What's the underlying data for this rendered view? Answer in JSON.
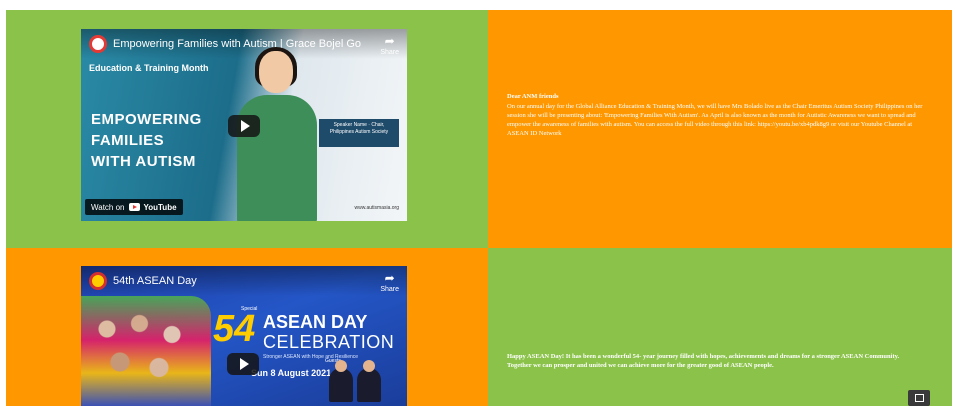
{
  "row1": {
    "video": {
      "title": "Empowering Families with Autism | Grace Bojel Go",
      "subtitle": "Education & Training Month",
      "headline_lines": [
        "EMPOWERING",
        "FAMILIES",
        "WITH AUTISM"
      ],
      "lower_third": "Speaker Name · Chair, Philippines Autism Society",
      "url": "www.autismasia.org",
      "watch_on": "Watch on",
      "youtube": "YouTube",
      "share": "Share"
    },
    "text": {
      "greeting": "Dear ANM friends",
      "body": "On our annual day for the Global Alliance Education & Training Month, we will have Mrs Bolado live as the Chair Emeritus Autism Society Philippines on her session she will be presenting about: 'Empowering Families With Autism'. As April is also known as the month for Autistic Awareness we want to spread and empower the awareness of families with autism. You can access the full video through this link: https://youtu.be/xb4pdk8g9 or visit our Youtube Channel at ASEAN ID Network"
    }
  },
  "row2": {
    "video": {
      "title": "54th ASEAN Day",
      "anniversary": "54",
      "pre_title": "Special",
      "title_line1": "ASEAN DAY",
      "title_line2": "CELEBRATION",
      "tagline": "Stronger ASEAN with Hope and Resilience",
      "date": "Sun 8 August 2021",
      "speakers": "Guests",
      "share": "Share"
    },
    "text": {
      "body": "Happy ASEAN Day! It has been a wonderful 54- year journey filled with hopes, achievements and dreams for a stronger ASEAN Community. Together we can prosper and united we can achieve more for the greater good of ASEAN people."
    }
  },
  "colors": {
    "green": "#8bc34a",
    "orange": "#ff9800"
  }
}
